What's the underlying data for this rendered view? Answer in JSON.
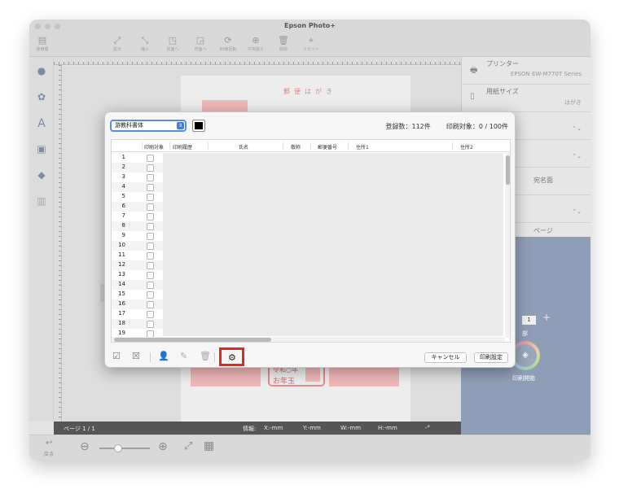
{
  "window": {
    "title": "Epson Photo+"
  },
  "toolbar": {
    "items": [
      {
        "label": "使用層",
        "icon": "layers-icon"
      },
      {
        "label": "拡大",
        "icon": "zoom-in-icon"
      },
      {
        "label": "縮小",
        "icon": "zoom-out-icon"
      },
      {
        "label": "前面へ",
        "icon": "bring-front-icon"
      },
      {
        "label": "背面へ",
        "icon": "send-back-icon"
      },
      {
        "label": "90度回転",
        "icon": "rotate-icon"
      },
      {
        "label": "中央揃え",
        "icon": "center-icon"
      },
      {
        "label": "削除",
        "icon": "trash-icon"
      },
      {
        "label": "リセット",
        "icon": "reset-icon"
      }
    ]
  },
  "right_panel": {
    "printer_label": "プリンター",
    "printer_value": "EPSON EW-M770T Series",
    "paper_size_label": "用紙サイズ",
    "paper_size_value": "はがき",
    "side_label": "宛名面",
    "page_value": "ページ",
    "copies": "1",
    "copies_unit": "部",
    "print_start": "印刷開始"
  },
  "postcard": {
    "title": "郵便はがき",
    "new_year_line1": "令和○年",
    "new_year_line2": "お年玉"
  },
  "status_bar": {
    "page": "ページ 1 / 1",
    "info": "情報:",
    "x": "X:-mm",
    "y": "Y:-mm",
    "w": "W:-mm",
    "h": "H:-mm",
    "angle": "-°"
  },
  "bottom_bar": {
    "back_label": "戻る"
  },
  "dialog": {
    "font_select": "游教科書体",
    "font_color": "#000000",
    "registered_count": "登録数：112件",
    "print_target": "印刷対象：0 / 100件",
    "columns": [
      "印刷対象",
      "印刷履歴",
      "氏名",
      "敬称",
      "郵便番号",
      "住所1",
      "住所2"
    ],
    "rows": [
      1,
      2,
      3,
      4,
      5,
      6,
      7,
      8,
      9,
      10,
      11,
      12,
      13,
      14,
      15,
      16,
      17,
      18,
      19
    ],
    "cancel_label": "キャンセル",
    "print_settings_label": "印刷設定"
  }
}
